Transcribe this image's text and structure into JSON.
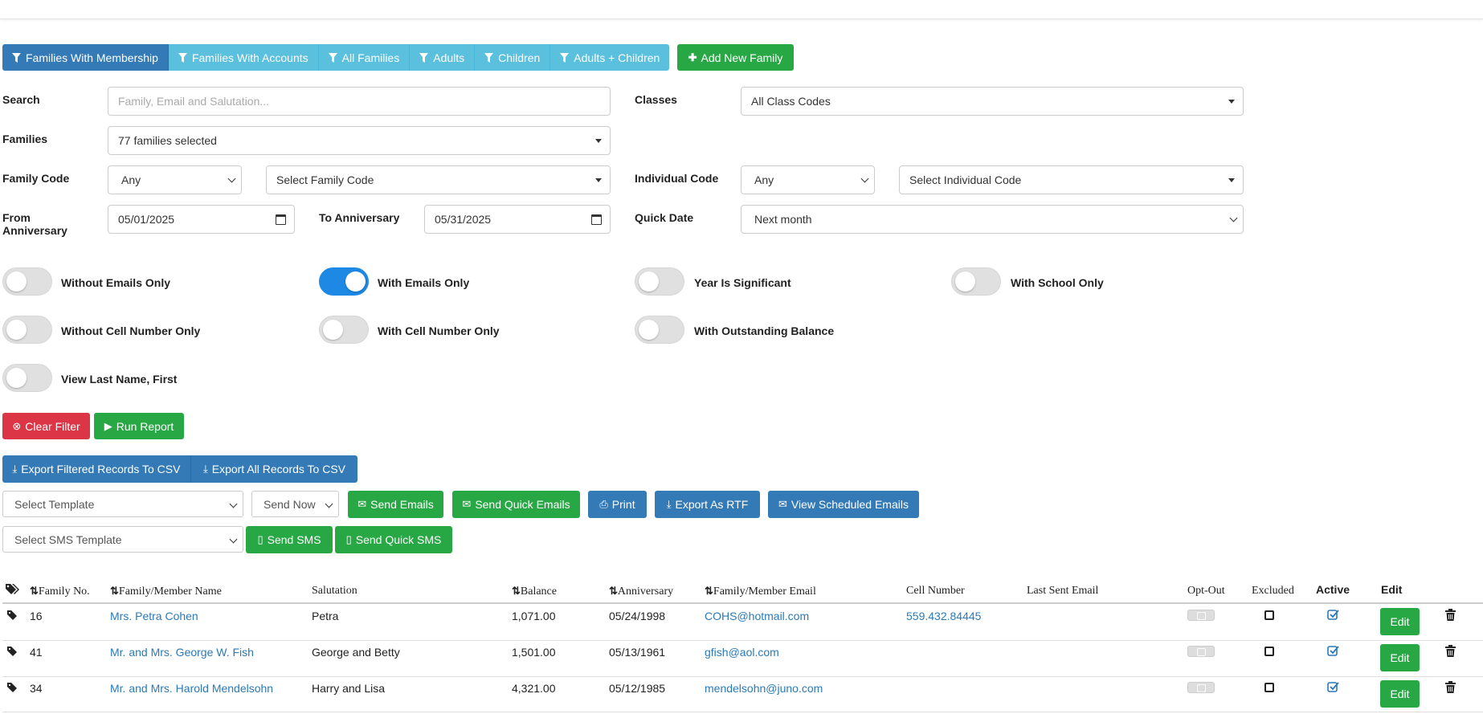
{
  "filter_tabs": [
    {
      "label": "Families With Membership",
      "active": true
    },
    {
      "label": "Families With Accounts",
      "active": false
    },
    {
      "label": "All Families",
      "active": false
    },
    {
      "label": "Adults",
      "active": false
    },
    {
      "label": "Children",
      "active": false
    },
    {
      "label": "Adults + Children",
      "active": false
    }
  ],
  "add_family_label": "Add New Family",
  "form": {
    "search_label": "Search",
    "search_placeholder": "Family, Email and Salutation...",
    "classes_label": "Classes",
    "classes_value": "All Class Codes",
    "families_label": "Families",
    "families_value": "77 families selected",
    "family_code_label": "Family Code",
    "family_code_op": "Any",
    "family_code_value": "Select Family Code",
    "individual_code_label": "Individual Code",
    "individual_code_op": "Any",
    "individual_code_value": "Select Individual Code",
    "from_anniversary_label_1": "From",
    "from_anniversary_label_2": "Anniversary",
    "from_anniversary_value": "05/01/2025",
    "to_anniversary_label": "To Anniversary",
    "to_anniversary_value": "05/31/2025",
    "quick_date_label": "Quick Date",
    "quick_date_value": "Next month"
  },
  "toggles": [
    {
      "label": "Without Emails Only",
      "on": false
    },
    {
      "label": "With Emails Only",
      "on": true
    },
    {
      "label": "Year Is Significant",
      "on": false
    },
    {
      "label": "With School Only",
      "on": false
    },
    {
      "label": "Without Cell Number Only",
      "on": false
    },
    {
      "label": "With Cell Number Only",
      "on": false
    },
    {
      "label": "With Outstanding Balance",
      "on": false
    },
    {
      "label": "View Last Name, First",
      "on": false
    }
  ],
  "actions": {
    "clear_filter": "Clear Filter",
    "run_report": "Run Report",
    "export_filtered": "Export Filtered Records To CSV",
    "export_all": "Export All Records To CSV",
    "select_template": "Select Template",
    "send_now": "Send Now",
    "send_emails": "Send Emails",
    "send_quick_emails": "Send Quick Emails",
    "print": "Print",
    "export_rtf": "Export As RTF",
    "view_scheduled": "View Scheduled Emails",
    "select_sms_template": "Select SMS Template",
    "send_sms": "Send SMS",
    "send_quick_sms": "Send Quick SMS"
  },
  "table": {
    "headers": {
      "family_no": "Family No.",
      "member_name": "Family/Member Name",
      "salutation": "Salutation",
      "balance": "Balance",
      "anniversary": "Anniversary",
      "email": "Family/Member Email",
      "cell": "Cell Number",
      "last_sent": "Last Sent Email",
      "opt_out": "Opt-Out",
      "excluded": "Excluded",
      "active": "Active",
      "edit": "Edit"
    },
    "edit_label": "Edit",
    "rows": [
      {
        "no": "16",
        "name": "Mrs. Petra Cohen",
        "salutation": "Petra",
        "balance": "1,071.00",
        "anniversary": "05/24/1998",
        "email": "COHS@hotmail.com",
        "cell": "559.432.84445"
      },
      {
        "no": "41",
        "name": "Mr. and Mrs. George W. Fish",
        "salutation": "George and Betty",
        "balance": "1,501.00",
        "anniversary": "05/13/1961",
        "email": "gfish@aol.com",
        "cell": ""
      },
      {
        "no": "34",
        "name": "Mr. and Mrs. Harold Mendelsohn",
        "salutation": "Harry and Lisa",
        "balance": "4,321.00",
        "anniversary": "05/12/1985",
        "email": "mendelsohn@juno.com",
        "cell": ""
      }
    ]
  },
  "colors": {
    "primary": "#337ab7",
    "info": "#5bc0de",
    "success": "#28a745",
    "danger": "#dc3545",
    "toggle_on": "#1e88e5",
    "link": "#2a7ab8"
  }
}
